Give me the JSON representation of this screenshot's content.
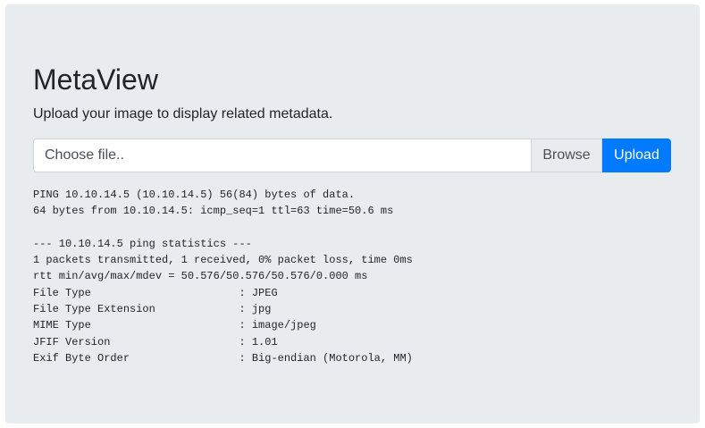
{
  "app": {
    "title": "MetaView",
    "subtitle": "Upload your image to display related metadata."
  },
  "upload_form": {
    "file_placeholder": "Choose file..",
    "browse_label": "Browse",
    "upload_label": "Upload"
  },
  "output": {
    "text": "PING 10.10.14.5 (10.10.14.5) 56(84) bytes of data.\n64 bytes from 10.10.14.5: icmp_seq=1 ttl=63 time=50.6 ms\n\n--- 10.10.14.5 ping statistics ---\n1 packets transmitted, 1 received, 0% packet loss, time 0ms\nrtt min/avg/max/mdev = 50.576/50.576/50.576/0.000 ms\nFile Type                       : JPEG\nFile Type Extension             : jpg\nMIME Type                       : image/jpeg\nJFIF Version                    : 1.01\nExif Byte Order                 : Big-endian (Motorola, MM)"
  },
  "colors": {
    "jumbotron_bg": "#e9ecef",
    "primary": "#007bff",
    "text": "#212529"
  }
}
